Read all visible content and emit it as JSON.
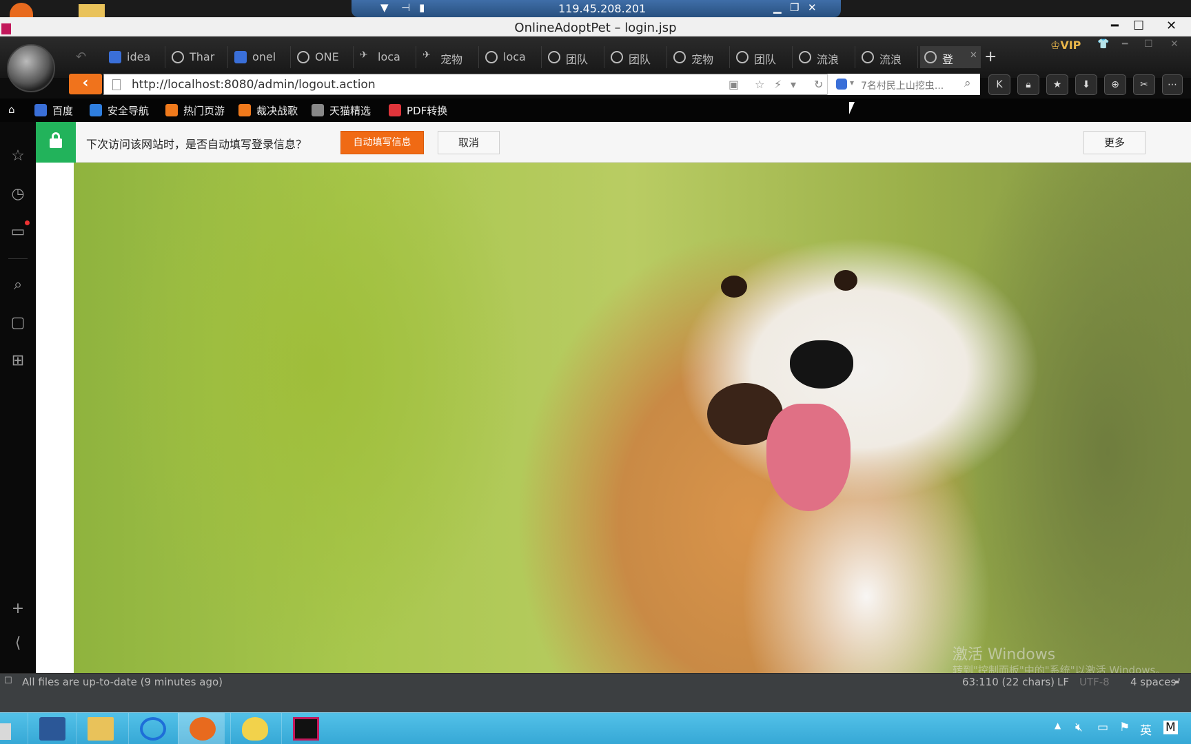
{
  "remote": {
    "ip": "119.45.208.201"
  },
  "ide": {
    "window_title": "OnlineAdoptPet – login.jsp",
    "status": {
      "message": "All files are up-to-date (9 minutes ago)",
      "position": "63:110 (22 chars)",
      "line_sep": "LF",
      "encoding": "UTF-8",
      "indent": "4 spaces"
    }
  },
  "browser": {
    "tabs": [
      {
        "label": "idea",
        "icon": "baidu-paw-icon"
      },
      {
        "label": "Thar",
        "icon": "globe-icon"
      },
      {
        "label": "onel",
        "icon": "baidu-paw-icon"
      },
      {
        "label": "ONE",
        "icon": "globe-icon"
      },
      {
        "label": "loca",
        "icon": "bird-icon"
      },
      {
        "label": "宠物",
        "icon": "bird-icon"
      },
      {
        "label": "loca",
        "icon": "globe-icon"
      },
      {
        "label": "团队",
        "icon": "globe-icon"
      },
      {
        "label": "团队",
        "icon": "globe-icon"
      },
      {
        "label": "宠物",
        "icon": "globe-icon"
      },
      {
        "label": "团队",
        "icon": "globe-icon"
      },
      {
        "label": "流浪",
        "icon": "globe-icon"
      },
      {
        "label": "流浪",
        "icon": "globe-icon"
      },
      {
        "label": "登",
        "icon": "globe-icon"
      }
    ],
    "vip_label": "VIP",
    "url": "http://localhost:8080/admin/logout.action",
    "search_placeholder": "7名村民上山挖虫...",
    "bookmarks": [
      {
        "label": "百度",
        "color": "#3a6fd8"
      },
      {
        "label": "安全导航",
        "color": "#2f7fe0"
      },
      {
        "label": "热门页游",
        "color": "#f07a1c"
      },
      {
        "label": "裁决战歌",
        "color": "#f07a1c"
      },
      {
        "label": "天猫精选",
        "color": "#888888"
      },
      {
        "label": "PDF转换",
        "color": "#e0353b"
      }
    ],
    "password_prompt": {
      "message": "下次访问该网站时，是否自动填写登录信息？",
      "autofill_label": "自动填写信息",
      "cancel_label": "取消",
      "more_label": "更多"
    }
  },
  "watermark": {
    "line1": "激活 Windows",
    "line2": "转到\"控制面板\"中的\"系统\"以激活 Windows。"
  },
  "taskbar": {
    "tray_lang": "英",
    "tray_m": "M"
  },
  "colors": {
    "accent_orange": "#f06a14",
    "lock_green": "#22b35b",
    "taskbar_blue": "#36a8d6"
  }
}
